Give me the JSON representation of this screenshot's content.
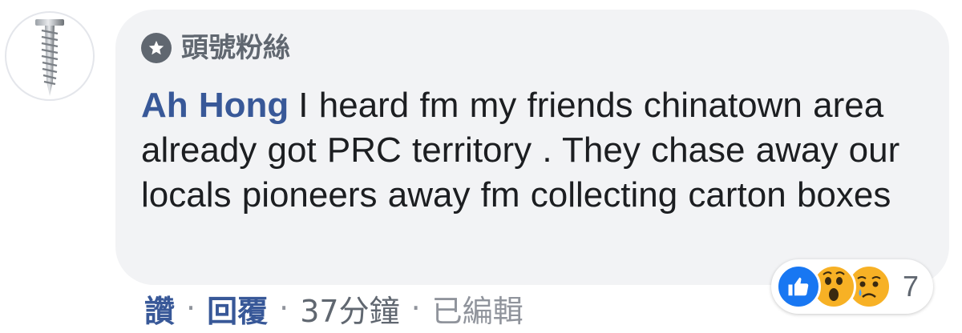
{
  "comment": {
    "badge_label": "頭號粉絲",
    "badge_icon": "star-badge-icon",
    "author": "Ah Hong",
    "text": "I heard fm my friends chinatown area already got PRC territory . They chase away our locals pioneers away fm collecting carton boxes",
    "avatar_icon": "screw-avatar-icon"
  },
  "actions": {
    "like_label": "讚",
    "separator": "·",
    "reply_label": "回覆",
    "timestamp": "37分鐘",
    "edited_label": "已編輯"
  },
  "reactions": {
    "icons": [
      "like-reaction-icon",
      "wow-reaction-icon",
      "sad-reaction-icon"
    ],
    "count": "7"
  },
  "colors": {
    "author": "#385898",
    "bubble": "#f2f3f5",
    "like": "#1877f2",
    "emoji": "#f7b125",
    "meta": "#90949c"
  }
}
